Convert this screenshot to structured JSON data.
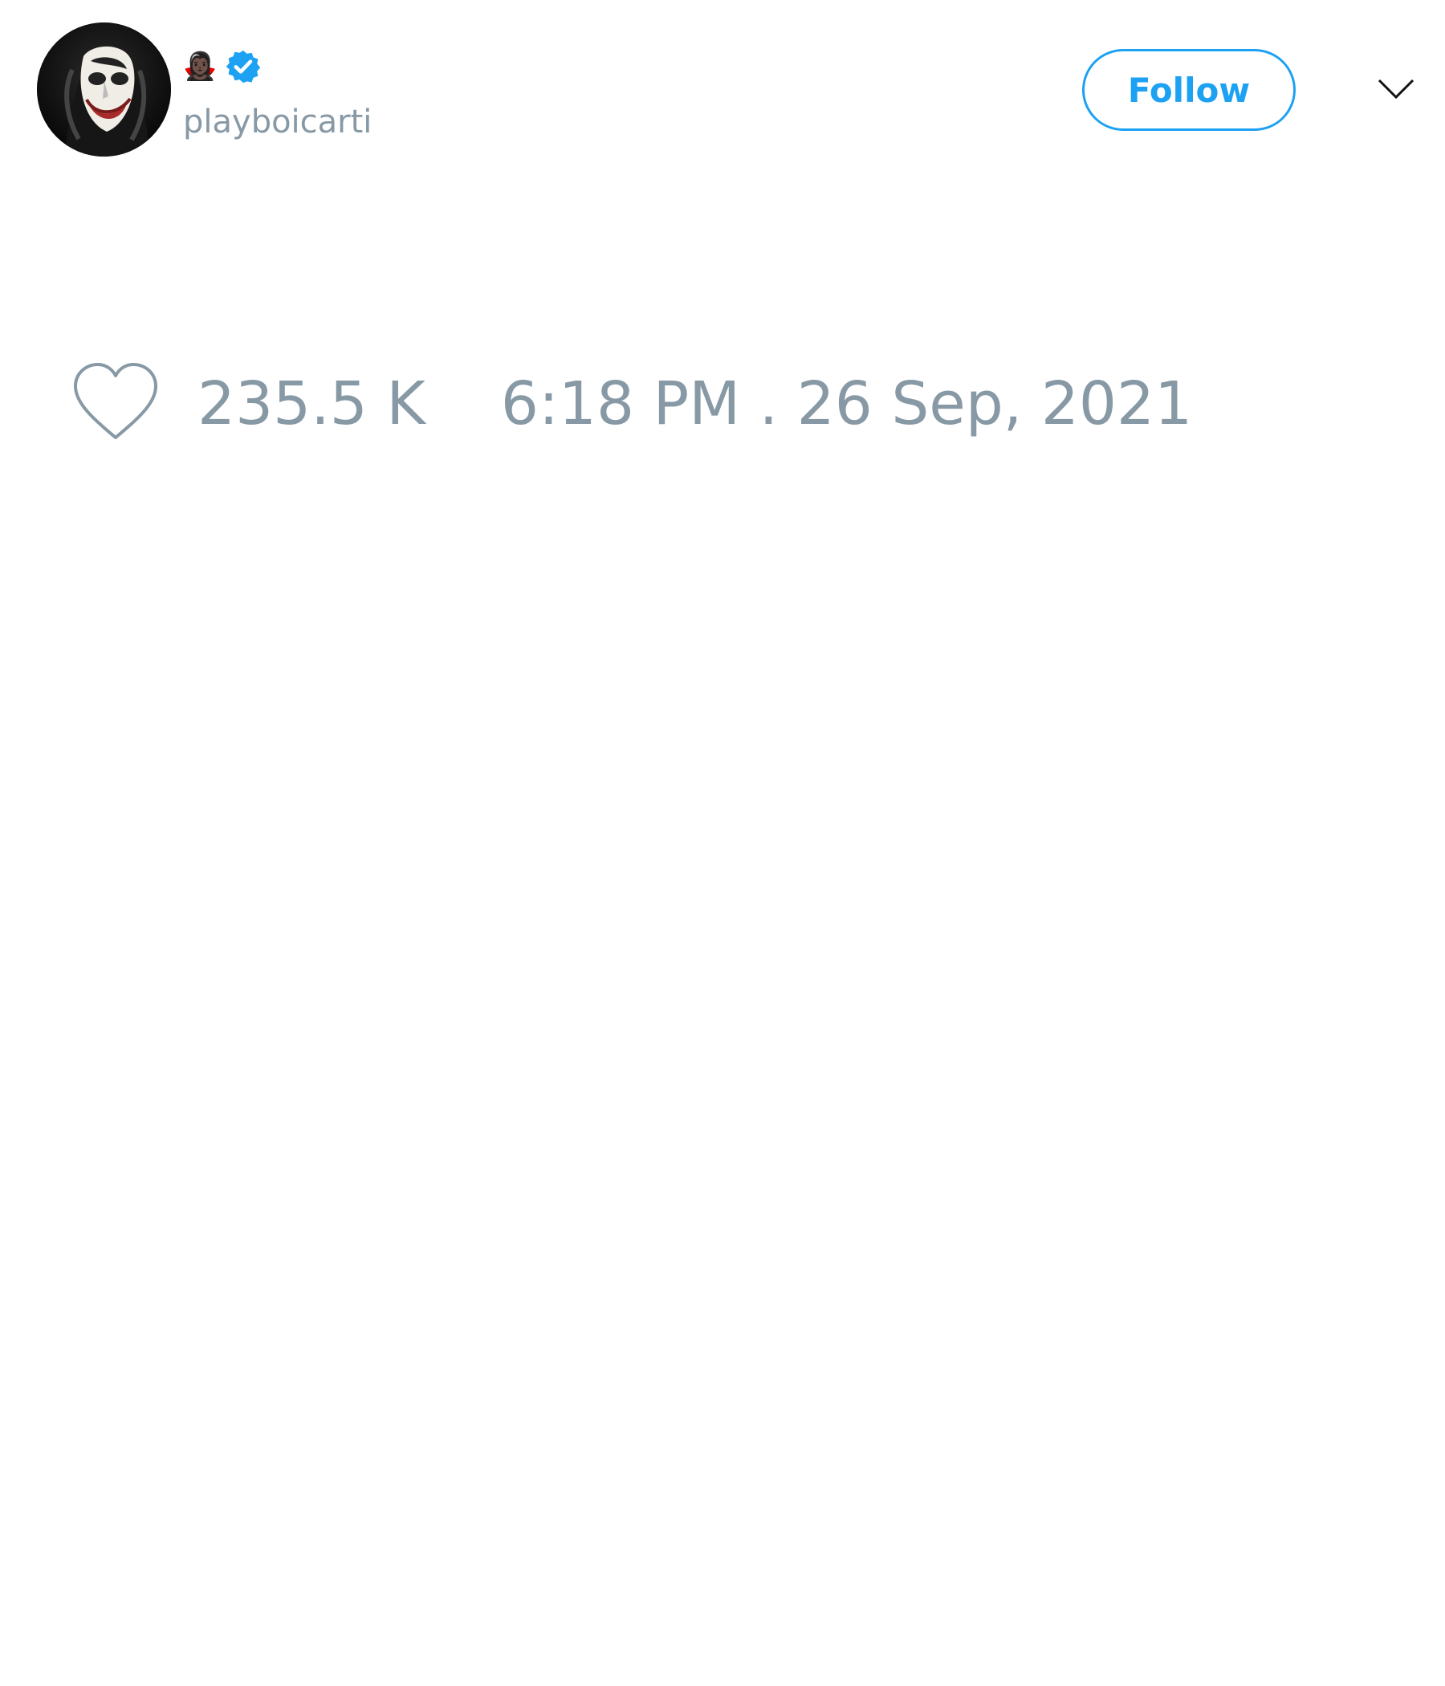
{
  "tweet": {
    "author": {
      "display_name": "🧛🏿‍♀️",
      "handle": "playboicarti",
      "verified": true,
      "avatar": "joker-face-portrait"
    },
    "follow_label": "Follow",
    "menu_icon": "chevron-down-icon",
    "likes": "235.5 K",
    "timestamp": "6:18 PM . 26 Sep, 2021"
  },
  "colors": {
    "accent": "#1da1f2",
    "muted_text": "#8899a6",
    "background": "#ffffff"
  },
  "icons": {
    "verified": "verified-badge-icon",
    "like": "heart-outline-icon",
    "menu": "chevron-down-icon"
  }
}
